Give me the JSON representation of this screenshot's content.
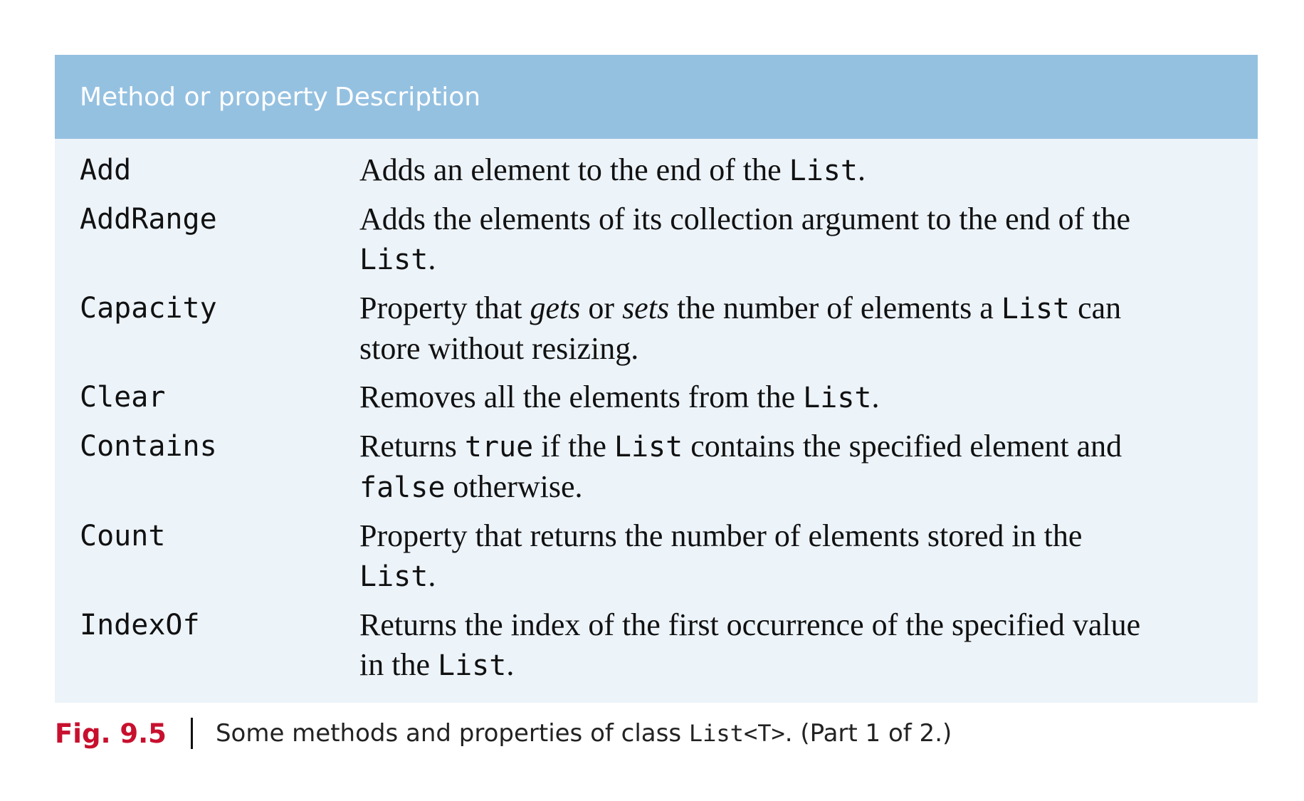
{
  "table": {
    "header": {
      "method": "Method or property",
      "description": "Description"
    },
    "rows": [
      {
        "method": "Add",
        "lines": [
          [
            {
              "t": "Adds an element to the end of the "
            },
            {
              "t": "List",
              "code": true
            },
            {
              "t": "."
            }
          ]
        ]
      },
      {
        "method": "AddRange",
        "lines": [
          [
            {
              "t": "Adds the elements of its collection argument to the end of the"
            }
          ],
          [
            {
              "t": "List",
              "code": true
            },
            {
              "t": "."
            }
          ]
        ]
      },
      {
        "method": "Capacity",
        "lines": [
          [
            {
              "t": "Property that "
            },
            {
              "t": "gets",
              "italic": true
            },
            {
              "t": " or "
            },
            {
              "t": "sets",
              "italic": true
            },
            {
              "t": " the number of elements a "
            },
            {
              "t": "List",
              "code": true
            },
            {
              "t": " can"
            }
          ],
          [
            {
              "t": "store without resizing."
            }
          ]
        ]
      },
      {
        "method": "Clear",
        "lines": [
          [
            {
              "t": "Removes all the elements from the "
            },
            {
              "t": "List",
              "code": true
            },
            {
              "t": "."
            }
          ]
        ]
      },
      {
        "method": "Contains",
        "lines": [
          [
            {
              "t": "Returns "
            },
            {
              "t": "true",
              "code": true
            },
            {
              "t": " if the "
            },
            {
              "t": "List",
              "code": true
            },
            {
              "t": " contains the specified element and"
            }
          ],
          [
            {
              "t": "false",
              "code": true
            },
            {
              "t": " otherwise."
            }
          ]
        ]
      },
      {
        "method": "Count",
        "lines": [
          [
            {
              "t": "Property that returns the number of elements stored in the"
            }
          ],
          [
            {
              "t": "List",
              "code": true
            },
            {
              "t": "."
            }
          ]
        ]
      },
      {
        "method": "IndexOf",
        "lines": [
          [
            {
              "t": "Returns the index of the first occurrence of the specified value"
            }
          ],
          [
            {
              "t": "in the "
            },
            {
              "t": "List",
              "code": true
            },
            {
              "t": "."
            }
          ]
        ]
      }
    ]
  },
  "caption": {
    "label": "Fig. 9.5",
    "text_before": "Some methods and properties of class ",
    "code": "List<T>",
    "text_after": ". (Part 1 of 2.)"
  },
  "colors": {
    "header_bg": "#95c1e1",
    "body_bg": "#ecf3f9",
    "fig_label": "#c8102e"
  }
}
